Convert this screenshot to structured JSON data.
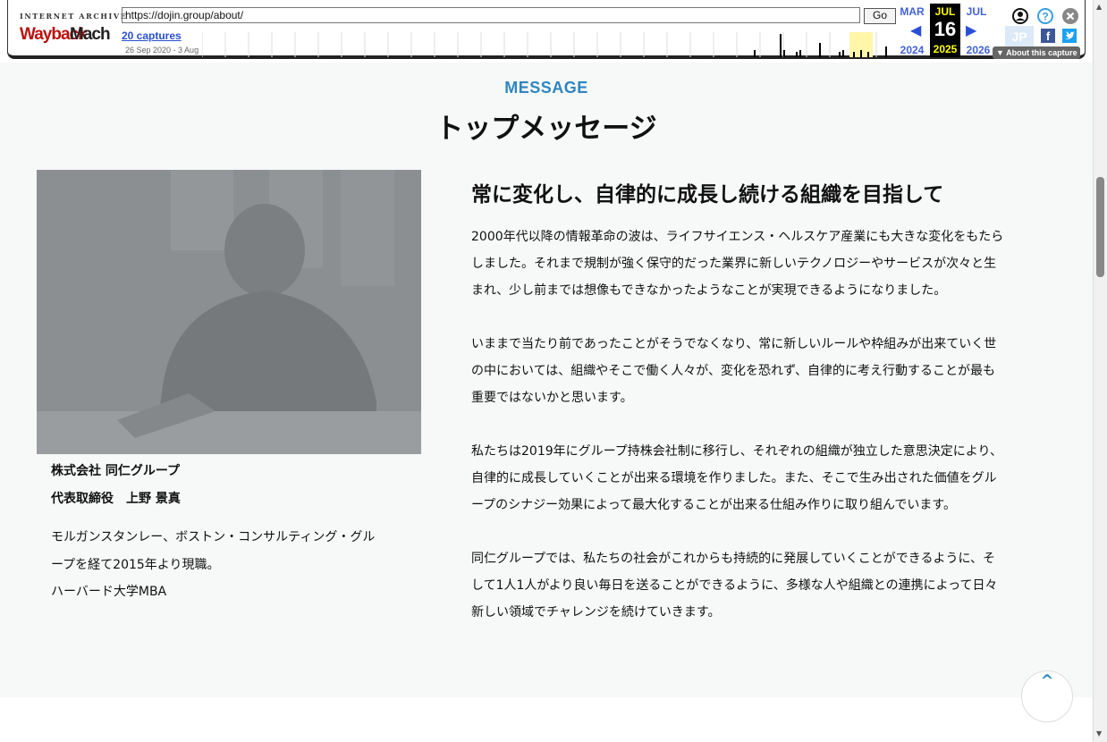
{
  "wayback": {
    "logo_top": "INTERNET ARCHIVE",
    "logo_main": "WaybackMachine",
    "url": "https://dojin.group/about/",
    "go_label": "Go",
    "captures_label": "20 captures",
    "date_range": "26 Sep 2020 - 3 Aug",
    "prev_month": "MAR",
    "prev_year": "2024",
    "cur_month": "JUL",
    "cur_day": "16",
    "cur_year": "2025",
    "next_month": "JUL",
    "next_year": "2026",
    "about_label": "About this capture",
    "jp_label": "JP",
    "icons": [
      "user-icon",
      "help-icon",
      "close-icon",
      "facebook-icon",
      "twitter-icon"
    ],
    "accent": "#2a4fd6"
  },
  "section": {
    "label": "MESSAGE",
    "title": "トップメッセージ",
    "label_color": "#2e86c1"
  },
  "profile": {
    "company": "株式会社 同仁グループ",
    "role": "代表取締役　上野 景真",
    "bio": [
      "モルガンスタンレー、ボストン・コンサルティング・グル",
      "ープを経て2015年より現職。",
      "ハーバード大学MBA"
    ]
  },
  "message": {
    "heading": "常に変化し、自律的に成長し続ける組織を目指して",
    "paragraphs": [
      [
        "2000年代以降の情報革命の波は、ライフサイエンス・ヘルスケア産業にも大きな変化をもたら",
        "しました。それまで規制が強く保守的だった業界に新しいテクノロジーやサービスが次々と生",
        "まれ、少し前までは想像もできなかったようなことが実現できるようになりました。"
      ],
      [
        "いままで当たり前であったことがそうでなくなり、常に新しいルールや枠組みが出来ていく世",
        "の中においては、組織やそこで働く人々が、変化を恐れず、自律的に考え行動することが最も",
        "重要ではないかと思います。"
      ],
      [
        "私たちは2019年にグループ持株会社制に移行し、それぞれの組織が独立した意思決定により、",
        "自律的に成長していくことが出来る環境を作りました。また、そこで生み出された価値をグル",
        "ープのシナジー効果によって最大化することが出来る仕組み作りに取り組んでいます。"
      ],
      [
        "同仁グループでは、私たちの社会がこれからも持続的に発展していくことができるように、そ",
        "して1人1人がより良い毎日を送ることができるように、多様な人や組織との連携によって日々",
        "新しい領域でチャレンジを続けていきます。"
      ]
    ]
  },
  "back_to_top_icon": "chevron-up-icon"
}
